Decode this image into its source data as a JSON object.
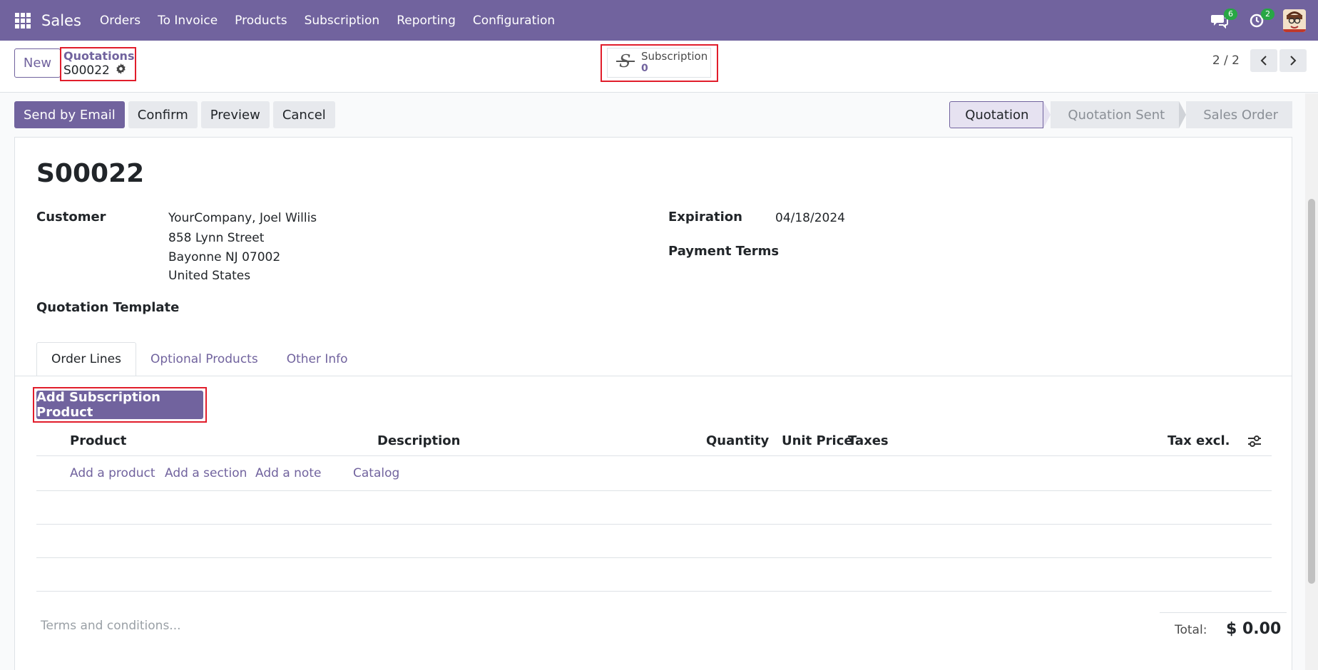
{
  "navbar": {
    "app_name": "Sales",
    "menu": [
      "Orders",
      "To Invoice",
      "Products",
      "Subscription",
      "Reporting",
      "Configuration"
    ],
    "messages_count": "6",
    "activities_count": "2",
    "accent_color": "#71639e"
  },
  "control_panel": {
    "new_label": "New",
    "breadcrumb_parent": "Quotations",
    "breadcrumb_current": "S00022",
    "smart_button": {
      "label": "Subscription",
      "value": "0"
    },
    "pager": "2 / 2"
  },
  "actions": {
    "send_email": "Send by Email",
    "confirm": "Confirm",
    "preview": "Preview",
    "cancel": "Cancel"
  },
  "status_stages": [
    "Quotation",
    "Quotation Sent",
    "Sales Order"
  ],
  "record": {
    "name": "S00022",
    "customer_label": "Customer",
    "customer_name": "YourCompany, Joel Willis",
    "address_line1": "858 Lynn Street",
    "address_line2": "Bayonne NJ 07002",
    "address_line3": "United States",
    "template_label": "Quotation Template",
    "expiration_label": "Expiration",
    "expiration_value": "04/18/2024",
    "payment_terms_label": "Payment Terms"
  },
  "tabs": [
    "Order Lines",
    "Optional Products",
    "Other Info"
  ],
  "order_lines": {
    "add_subscription_label": "Add Subscription Product",
    "columns": [
      "Product",
      "Description",
      "Quantity",
      "Unit Price",
      "Taxes",
      "Tax excl."
    ],
    "add_links": [
      "Add a product",
      "Add a section",
      "Add a note",
      "Catalog"
    ]
  },
  "footer": {
    "terms_placeholder": "Terms and conditions...",
    "total_label": "Total:",
    "total_value": "$ 0.00"
  }
}
